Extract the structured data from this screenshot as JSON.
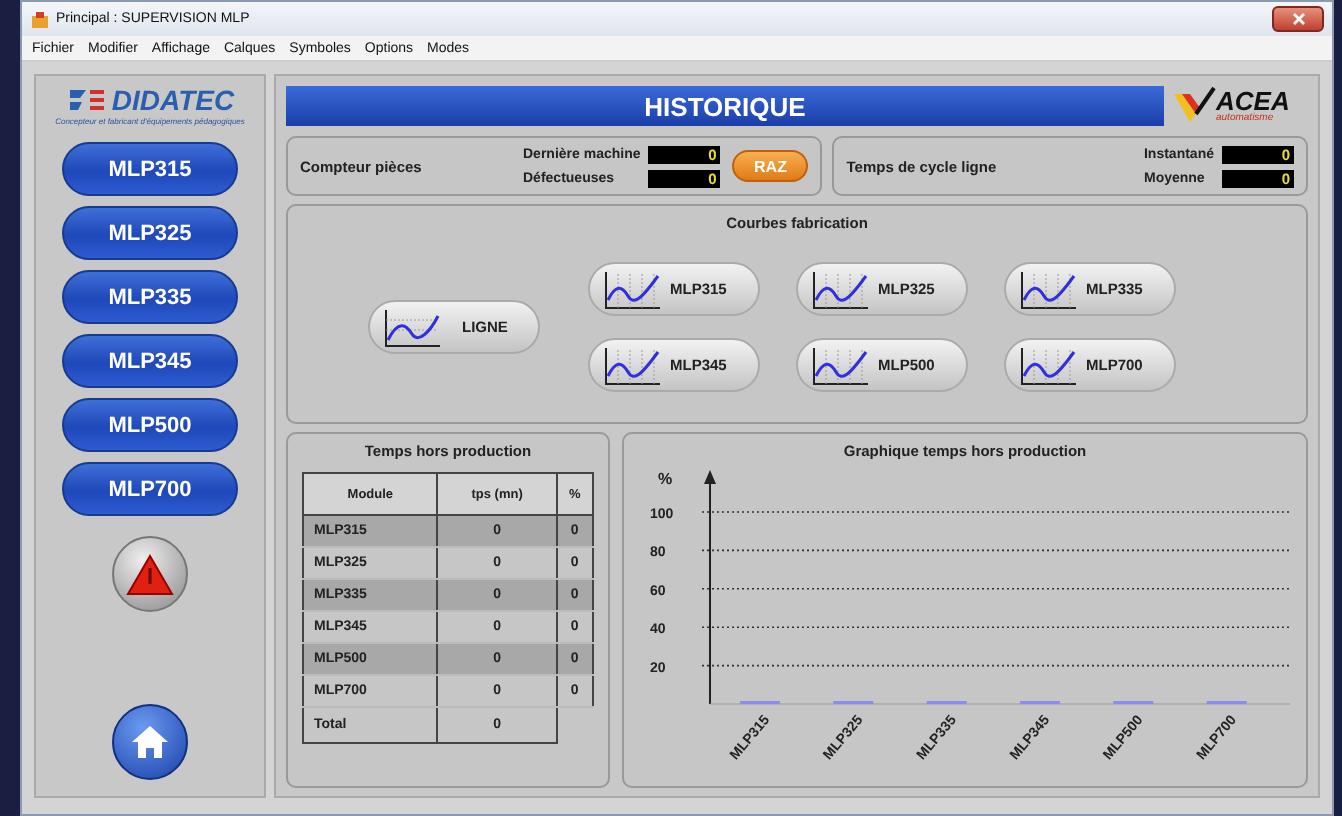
{
  "window": {
    "title": "Principal : SUPERVISION MLP"
  },
  "menu": [
    "Fichier",
    "Modifier",
    "Affichage",
    "Calques",
    "Symboles",
    "Options",
    "Modes"
  ],
  "logo": {
    "name": "DIDATEC",
    "tagline": "Concepteur et fabricant d'équipements pédagogiques"
  },
  "sidebar": {
    "buttons": [
      "MLP315",
      "MLP325",
      "MLP335",
      "MLP345",
      "MLP500",
      "MLP700"
    ]
  },
  "header": {
    "title": "HISTORIQUE",
    "brand": "ACEA",
    "brand_sub": "automatisme"
  },
  "counters": {
    "label": "Compteur pièces",
    "fields": [
      {
        "label": "Dernière machine",
        "value": "0"
      },
      {
        "label": "Défectueuses",
        "value": "0"
      }
    ],
    "reset": "RAZ"
  },
  "cycle": {
    "label": "Temps de cycle ligne",
    "fields": [
      {
        "label": "Instantané",
        "value": "0"
      },
      {
        "label": "Moyenne",
        "value": "0"
      }
    ]
  },
  "curves": {
    "title": "Courbes fabrication",
    "line_button": "LIGNE",
    "buttons": [
      "MLP315",
      "MLP325",
      "MLP335",
      "MLP345",
      "MLP500",
      "MLP700"
    ]
  },
  "downtime_table": {
    "title": "Temps hors production",
    "columns": [
      "Module",
      "tps (mn)",
      "%"
    ],
    "rows": [
      [
        "MLP315",
        "0",
        "0"
      ],
      [
        "MLP325",
        "0",
        "0"
      ],
      [
        "MLP335",
        "0",
        "0"
      ],
      [
        "MLP345",
        "0",
        "0"
      ],
      [
        "MLP500",
        "0",
        "0"
      ],
      [
        "MLP700",
        "0",
        "0"
      ]
    ],
    "total": {
      "label": "Total",
      "value": "0"
    }
  },
  "downtime_chart": {
    "chart_data": {
      "type": "bar",
      "title": "Graphique temps hors production",
      "ylabel": "%",
      "categories": [
        "MLP315",
        "MLP325",
        "MLP335",
        "MLP345",
        "MLP500",
        "MLP700"
      ],
      "values": [
        0,
        0,
        0,
        0,
        0,
        0
      ],
      "ylim": [
        0,
        100
      ],
      "grid": true,
      "yticks": [
        20,
        40,
        60,
        80,
        100
      ]
    }
  }
}
